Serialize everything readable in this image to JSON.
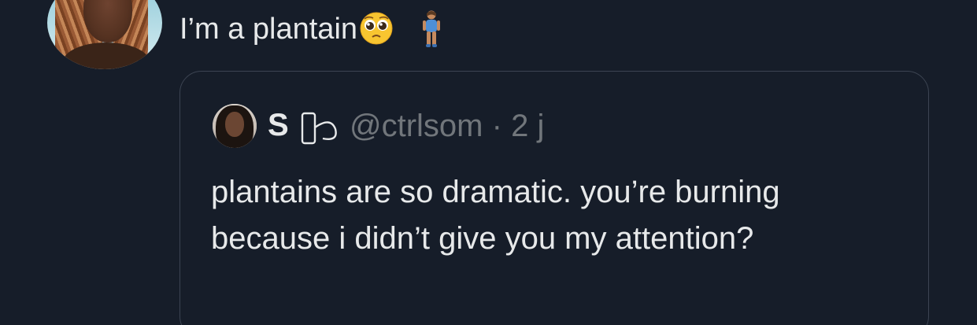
{
  "tweet": {
    "text": "I’m a plantain",
    "emojis": [
      "pleading-face-emoji",
      "standing-person-emoji"
    ]
  },
  "quoted_tweet": {
    "display_name": "S",
    "name_emoji": "unknown-symbol-emoji",
    "handle": "@ctrlsom",
    "separator": "·",
    "time": "2 j",
    "text": "plantains are so dramatic. you’re burning because i didn’t give you my attention?"
  },
  "colors": {
    "background": "#161d29",
    "text_primary": "#e7e9ea",
    "text_secondary": "#71767b",
    "border": "#3c4452"
  }
}
